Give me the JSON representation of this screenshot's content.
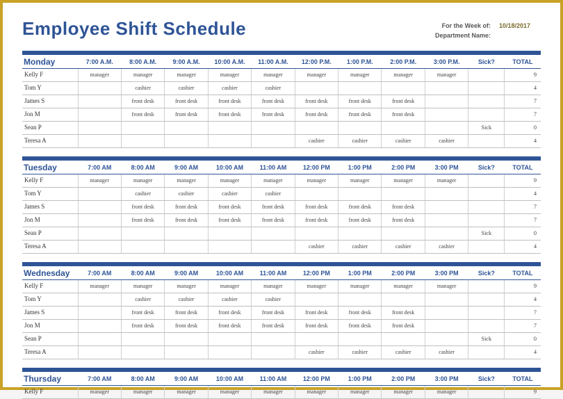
{
  "title": "Employee Shift Schedule",
  "meta": {
    "week_label": "For the Week of:",
    "week_value": "10/18/2017",
    "dept_label": "Department Name:",
    "dept_value": ""
  },
  "columns": {
    "sick": "Sick?",
    "total": "TOTAL"
  },
  "days": [
    {
      "name": "Monday",
      "times": [
        "7:00 A.M.",
        "8:00 A.M.",
        "9:00 A.M.",
        "10:00 A.M.",
        "11:00 A.M.",
        "12:00 P.M.",
        "1:00 P.M.",
        "2:00 P.M.",
        "3:00 P.M."
      ],
      "rows": [
        {
          "emp": "Kelly F",
          "cells": [
            "manager",
            "manager",
            "manager",
            "manager",
            "manager",
            "manager",
            "manager",
            "manager",
            "manager"
          ],
          "sick": "",
          "total": "9"
        },
        {
          "emp": "Tom Y",
          "cells": [
            "",
            "cashier",
            "cashier",
            "cashier",
            "cashier",
            "",
            "",
            "",
            ""
          ],
          "sick": "",
          "total": "4"
        },
        {
          "emp": "James S",
          "cells": [
            "",
            "front desk",
            "front desk",
            "front desk",
            "front desk",
            "front desk",
            "front desk",
            "front desk",
            ""
          ],
          "sick": "",
          "total": "7"
        },
        {
          "emp": "Jon M",
          "cells": [
            "",
            "front desk",
            "front desk",
            "front desk",
            "front desk",
            "front desk",
            "front desk",
            "front desk",
            ""
          ],
          "sick": "",
          "total": "7"
        },
        {
          "emp": "Sean P",
          "cells": [
            "",
            "",
            "",
            "",
            "",
            "",
            "",
            "",
            ""
          ],
          "sick": "Sick",
          "total": "0"
        },
        {
          "emp": "Teresa A",
          "cells": [
            "",
            "",
            "",
            "",
            "",
            "cashier",
            "cashier",
            "cashier",
            "cashier"
          ],
          "sick": "",
          "total": "4"
        }
      ]
    },
    {
      "name": "Tuesday",
      "times": [
        "7:00 AM",
        "8:00 AM",
        "9:00 AM",
        "10:00 AM",
        "11:00 AM",
        "12:00 PM",
        "1:00 PM",
        "2:00 PM",
        "3:00 PM"
      ],
      "rows": [
        {
          "emp": "Kelly F",
          "cells": [
            "manager",
            "manager",
            "manager",
            "manager",
            "manager",
            "manager",
            "manager",
            "manager",
            "manager"
          ],
          "sick": "",
          "total": "9"
        },
        {
          "emp": "Tom Y",
          "cells": [
            "",
            "cashier",
            "cashier",
            "cashier",
            "cashier",
            "",
            "",
            "",
            ""
          ],
          "sick": "",
          "total": "4"
        },
        {
          "emp": "James S",
          "cells": [
            "",
            "front desk",
            "front desk",
            "front desk",
            "front desk",
            "front desk",
            "front desk",
            "front desk",
            ""
          ],
          "sick": "",
          "total": "7"
        },
        {
          "emp": "Jon M",
          "cells": [
            "",
            "front desk",
            "front desk",
            "front desk",
            "front desk",
            "front desk",
            "front desk",
            "front desk",
            ""
          ],
          "sick": "",
          "total": "7"
        },
        {
          "emp": "Sean P",
          "cells": [
            "",
            "",
            "",
            "",
            "",
            "",
            "",
            "",
            ""
          ],
          "sick": "Sick",
          "total": "0"
        },
        {
          "emp": "Teresa A",
          "cells": [
            "",
            "",
            "",
            "",
            "",
            "cashier",
            "cashier",
            "cashier",
            "cashier"
          ],
          "sick": "",
          "total": "4"
        }
      ]
    },
    {
      "name": "Wednesday",
      "times": [
        "7:00 AM",
        "8:00 AM",
        "9:00 AM",
        "10:00 AM",
        "11:00 AM",
        "12:00 PM",
        "1:00 PM",
        "2:00 PM",
        "3:00 PM"
      ],
      "rows": [
        {
          "emp": "Kelly F",
          "cells": [
            "manager",
            "manager",
            "manager",
            "manager",
            "manager",
            "manager",
            "manager",
            "manager",
            "manager"
          ],
          "sick": "",
          "total": "9"
        },
        {
          "emp": "Tom Y",
          "cells": [
            "",
            "cashier",
            "cashier",
            "cashier",
            "cashier",
            "",
            "",
            "",
            ""
          ],
          "sick": "",
          "total": "4"
        },
        {
          "emp": "James S",
          "cells": [
            "",
            "front desk",
            "front desk",
            "front desk",
            "front desk",
            "front desk",
            "front desk",
            "front desk",
            ""
          ],
          "sick": "",
          "total": "7"
        },
        {
          "emp": "Jon M",
          "cells": [
            "",
            "front desk",
            "front desk",
            "front desk",
            "front desk",
            "front desk",
            "front desk",
            "front desk",
            ""
          ],
          "sick": "",
          "total": "7"
        },
        {
          "emp": "Sean P",
          "cells": [
            "",
            "",
            "",
            "",
            "",
            "",
            "",
            "",
            ""
          ],
          "sick": "Sick",
          "total": "0"
        },
        {
          "emp": "Teresa A",
          "cells": [
            "",
            "",
            "",
            "",
            "",
            "cashier",
            "cashier",
            "cashier",
            "cashier"
          ],
          "sick": "",
          "total": "4"
        }
      ]
    },
    {
      "name": "Thursday",
      "times": [
        "7:00 AM",
        "8:00 AM",
        "9:00 AM",
        "10:00 AM",
        "11:00 AM",
        "12:00 PM",
        "1:00 PM",
        "2:00 PM",
        "3:00 PM"
      ],
      "rows": [
        {
          "emp": "Kelly F",
          "cells": [
            "manager",
            "manager",
            "manager",
            "manager",
            "manager",
            "manager",
            "manager",
            "manager",
            "manager"
          ],
          "sick": "",
          "total": "9"
        }
      ]
    }
  ],
  "watermark": ""
}
